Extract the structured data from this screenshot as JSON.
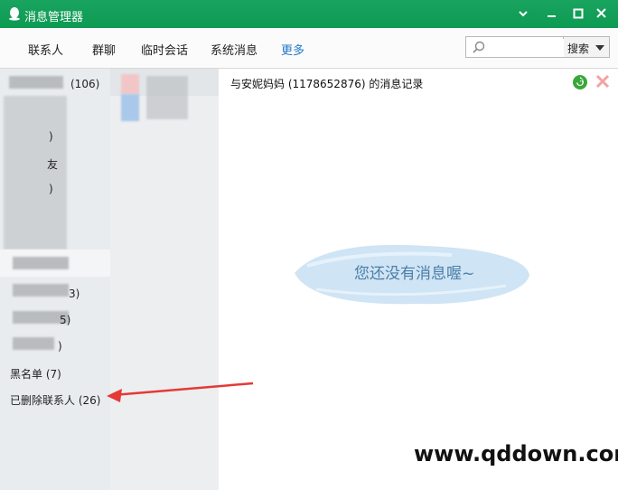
{
  "window": {
    "title": "消息管理器"
  },
  "toolbar": {
    "tabs": [
      "联系人",
      "群聊",
      "临时会话",
      "系统消息"
    ],
    "more_label": "更多",
    "search_placeholder": "",
    "search_button_label": "搜索"
  },
  "contact_groups": [
    {
      "label": "(106)"
    },
    {
      "label": ")"
    },
    {
      "label": "友"
    },
    {
      "label": ")"
    },
    {
      "label": "3)"
    },
    {
      "label": "5)"
    },
    {
      "label": ")"
    },
    {
      "label": "黑名单 (7)"
    },
    {
      "label": "已删除联系人 (26)"
    }
  ],
  "record": {
    "title": "与安妮妈妈 (1178652876) 的消息记录",
    "empty_message": "您还没有消息喔~"
  },
  "watermark": "www.qddown.com",
  "colors": {
    "titlebar": "#0f9d58",
    "more_tab": "#1f78c8",
    "arrow": "#e53935",
    "empty_text": "#4a7ea8"
  }
}
